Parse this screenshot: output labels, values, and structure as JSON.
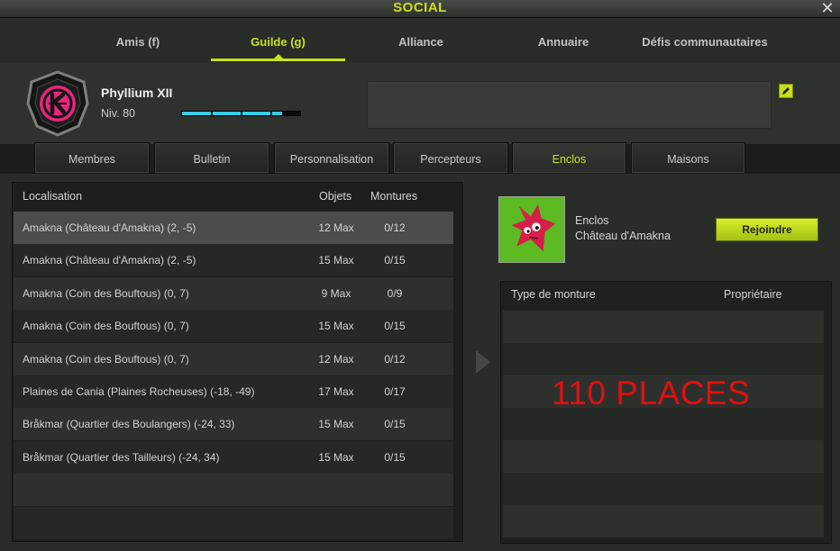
{
  "window": {
    "title": "SOCIAL"
  },
  "main_tabs": [
    "Amis (f)",
    "Guilde (g)",
    "Alliance",
    "Annuaire",
    "Défis communautaires"
  ],
  "guild": {
    "name": "Phyllium XII",
    "level": "Niv. 80",
    "xp_progress": 0.85
  },
  "sub_tabs": [
    "Membres",
    "Bulletin",
    "Personnalisation",
    "Percepteurs",
    "Enclos",
    "Maisons"
  ],
  "enclos_list": {
    "columns": [
      "Localisation",
      "Objets",
      "Montures"
    ],
    "rows": [
      {
        "location": "Amakna (Château d'Amakna) (2, -5)",
        "objects": "12 Max",
        "mounts": "0/12"
      },
      {
        "location": "Amakna (Château d'Amakna) (2, -5)",
        "objects": "15 Max",
        "mounts": "0/15"
      },
      {
        "location": "Amakna (Coin des Bouftous) (0, 7)",
        "objects": "9 Max",
        "mounts": "0/9"
      },
      {
        "location": "Amakna (Coin des Bouftous) (0, 7)",
        "objects": "15 Max",
        "mounts": "0/15"
      },
      {
        "location": "Amakna (Coin des Bouftous) (0, 7)",
        "objects": "12 Max",
        "mounts": "0/12"
      },
      {
        "location": "Plaines de Cania (Plaines Rocheuses) (-18, -49)",
        "objects": "17 Max",
        "mounts": "0/17"
      },
      {
        "location": "Bråkmar (Quartier des Boulangers) (-24, 33)",
        "objects": "15 Max",
        "mounts": "0/15"
      },
      {
        "location": "Bråkmar (Quartier des Tailleurs) (-24, 34)",
        "objects": "15 Max",
        "mounts": "0/15"
      }
    ]
  },
  "detail": {
    "label": "Enclos",
    "place": "Château d'Amakna",
    "join_button": "Rejoindre",
    "columns": [
      "Type de monture",
      "Propriétaire"
    ],
    "overlay_text": "110 PLACES"
  },
  "colors": {
    "accent": "#c9e11b",
    "xp_bar": "#36cde4",
    "overlay_text": "#e01010"
  }
}
